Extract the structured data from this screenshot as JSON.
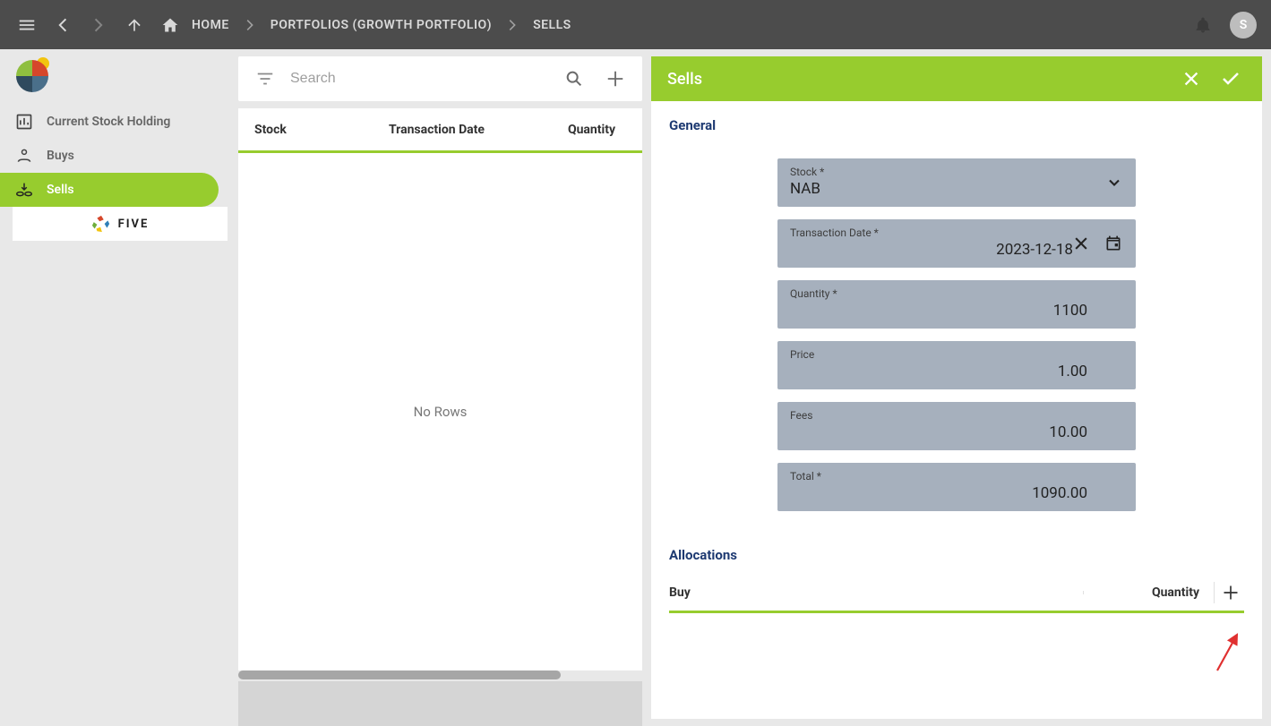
{
  "appbar": {
    "breadcrumbs": [
      {
        "label": "HOME"
      },
      {
        "label": "PORTFOLIOS (GROWTH PORTFOLIO)"
      },
      {
        "label": "SELLS"
      }
    ],
    "avatar_initial": "S"
  },
  "sidebar": {
    "items": [
      {
        "label": "Current Stock Holding",
        "icon": "chart-icon",
        "active": false
      },
      {
        "label": "Buys",
        "icon": "hand-icon",
        "active": false
      },
      {
        "label": "Sells",
        "icon": "coins-icon",
        "active": true
      }
    ],
    "footer_brand": "FIVE"
  },
  "center": {
    "search_placeholder": "Search",
    "columns": [
      {
        "label": "Stock"
      },
      {
        "label": "Transaction Date"
      },
      {
        "label": "Quantity"
      }
    ],
    "empty_text": "No Rows"
  },
  "right": {
    "title": "Sells",
    "general_title": "General",
    "fields": {
      "stock": {
        "label": "Stock *",
        "value": "NAB"
      },
      "transaction_date": {
        "label": "Transaction Date *",
        "value": "2023-12-18"
      },
      "quantity": {
        "label": "Quantity *",
        "value": "1100"
      },
      "price": {
        "label": "Price",
        "value": "1.00"
      },
      "fees": {
        "label": "Fees",
        "value": "10.00"
      },
      "total": {
        "label": "Total *",
        "value": "1090.00"
      }
    },
    "allocations_title": "Allocations",
    "alloc_columns": {
      "buy": "Buy",
      "qty": "Quantity"
    }
  }
}
